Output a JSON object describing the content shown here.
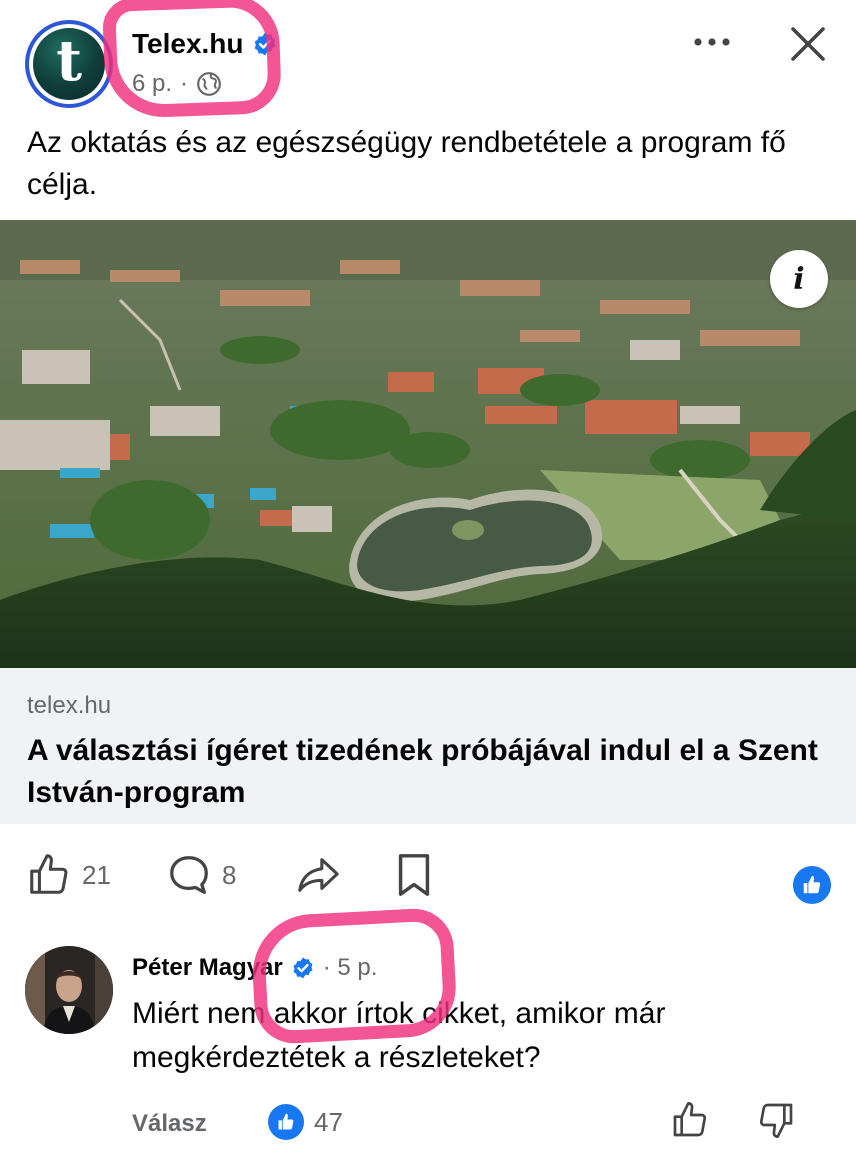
{
  "post": {
    "page_name": "Telex.hu",
    "avatar_letter": "t",
    "time": "6 p.",
    "separator": "·",
    "text": "Az oktatás és az egészségügy rendbetétele a program fő célja."
  },
  "link": {
    "domain": "telex.hu",
    "title": "A választási ígéret tizedének próbájával indul el a Szent István-program",
    "info_label": "i"
  },
  "actions": {
    "like_count": "21",
    "comment_count": "8"
  },
  "comment": {
    "author": "Péter Magyar",
    "time": "· 5 p.",
    "text": "Miért nem akkor írtok cikket, amikor már megkérdeztétek a részleteket?",
    "reply_label": "Válasz",
    "reaction_count": "47"
  },
  "colors": {
    "accent": "#1877f2",
    "highlight": "#f0307e",
    "muted": "#65676b",
    "card_bg": "#f0f2f5"
  }
}
